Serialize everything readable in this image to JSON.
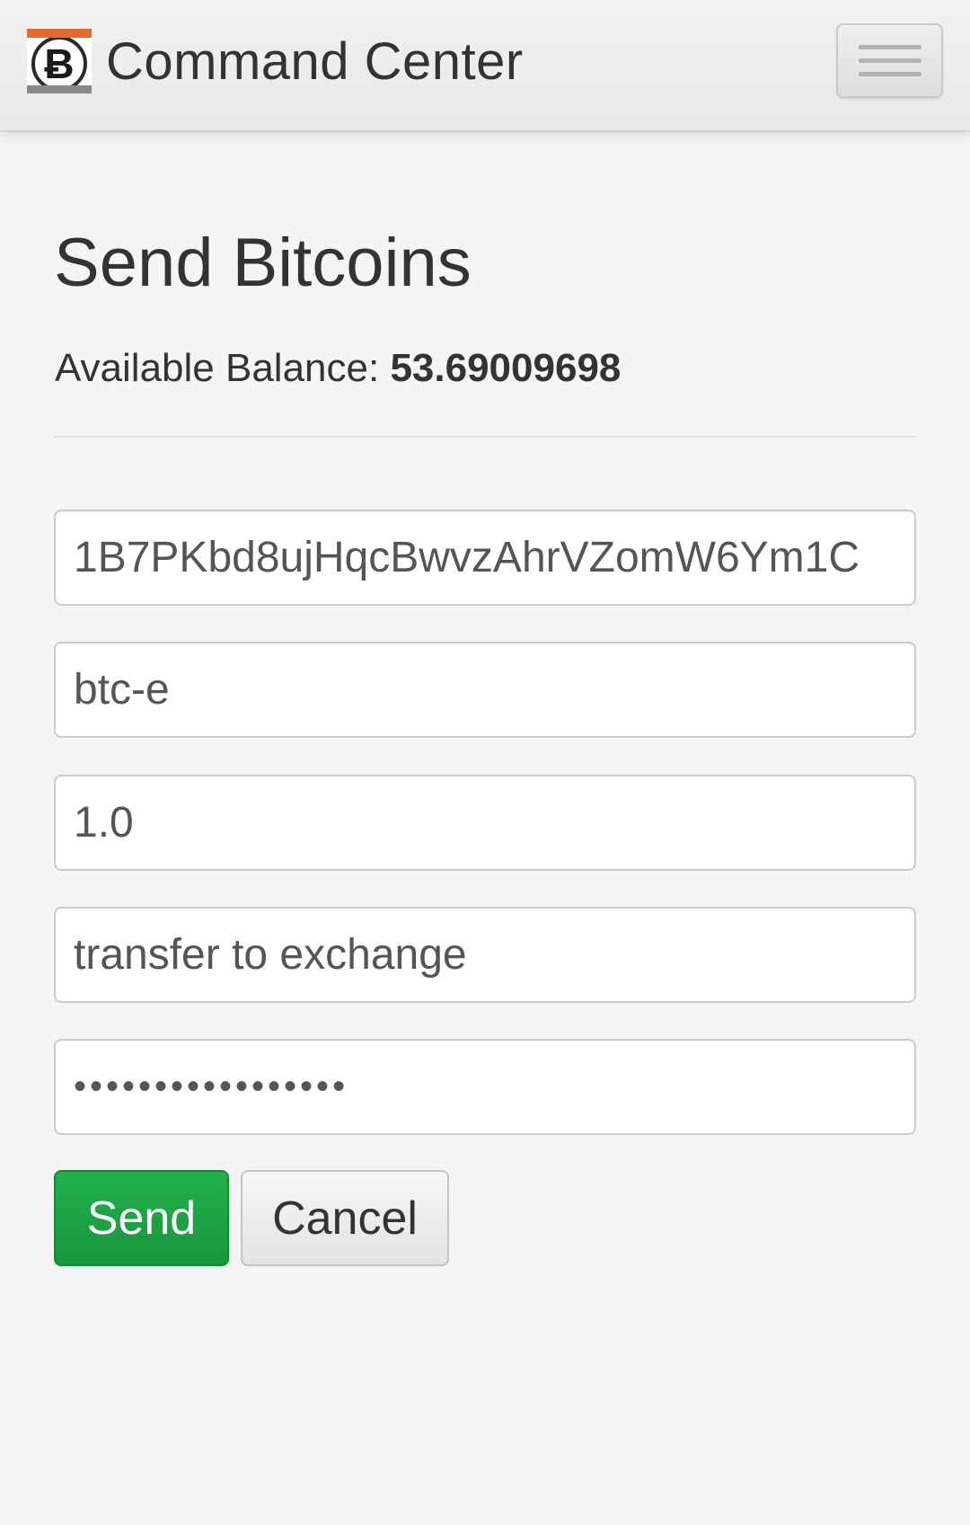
{
  "navbar": {
    "logo_glyph": "Ƀ",
    "brand_title": "Command Center",
    "menu_icon": "hamburger-menu-icon"
  },
  "page": {
    "title": "Send Bitcoins",
    "balance_label": "Available Balance:",
    "balance_value": "53.69009698"
  },
  "form": {
    "address_value": "1B7PKbd8ujHqcBwvzAhrVZomW6Ym1C",
    "label_value": "btc-e",
    "amount_value": "1.0",
    "memo_value": "transfer to exchange",
    "password_value": "•••••••••••••••••"
  },
  "buttons": {
    "send_label": "Send",
    "cancel_label": "Cancel"
  },
  "colors": {
    "accent_orange": "#e8692c",
    "send_green": "#1aa345",
    "background": "#f5f5f5"
  }
}
